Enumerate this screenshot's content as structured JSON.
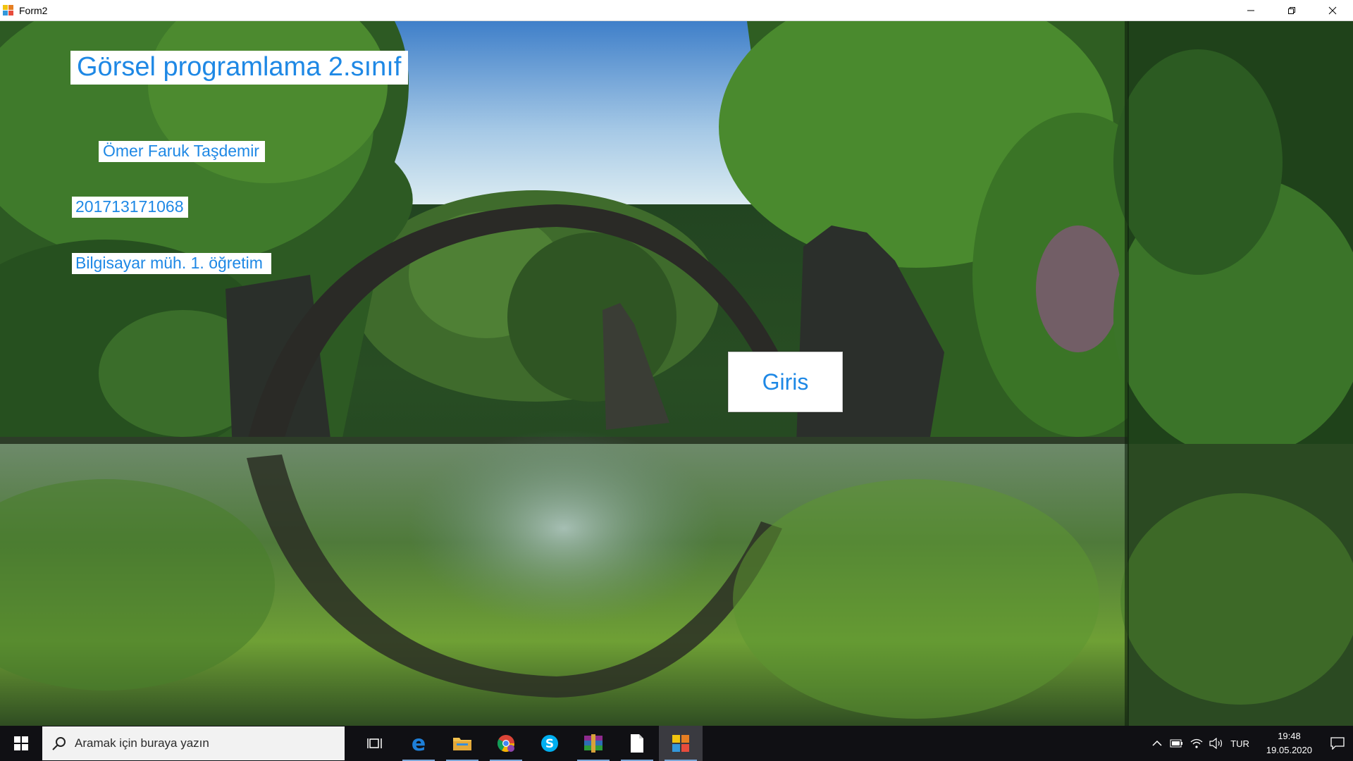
{
  "window": {
    "title": "Form2"
  },
  "form": {
    "title_label": "Görsel programlama 2.sınıf",
    "name_label": "Ömer Faruk Taşdemir",
    "id_label": "201713171068",
    "department_label": "Bilgisayar müh. 1. öğretim",
    "button_label": "Giris",
    "label_color": "#1e88e5",
    "background_image": "forest-arch-bridge-reflection"
  },
  "taskbar": {
    "search_placeholder": "Aramak için buraya yazın",
    "apps": [
      "task-view-icon",
      "edge-icon",
      "file-explorer-icon",
      "chrome-icon",
      "skype-icon",
      "winrar-icon",
      "document-icon",
      "form-app-icon"
    ],
    "language": "TUR",
    "time": "19:48",
    "date": "19.05.2020"
  }
}
